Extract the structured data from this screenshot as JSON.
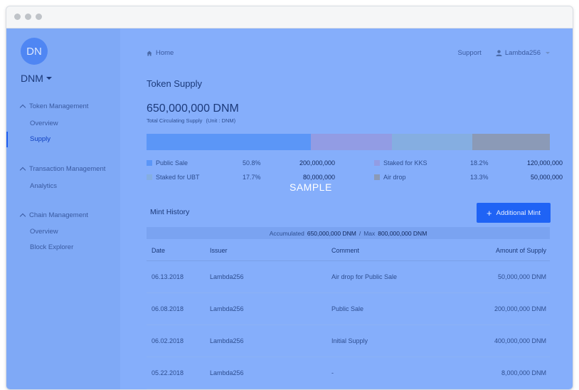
{
  "account": {
    "initials": "DN",
    "name": "DNM"
  },
  "sidebar": {
    "sections": [
      {
        "title": "Token Management",
        "items": [
          "Overview",
          "Supply"
        ]
      },
      {
        "title": "Transaction Management",
        "items": [
          "Analytics"
        ]
      },
      {
        "title": "Chain Management",
        "items": [
          "Overview",
          "Block Explorer"
        ]
      }
    ],
    "active_item": "Supply"
  },
  "header": {
    "breadcrumb": "Home",
    "support": "Support",
    "user": "Lambda256"
  },
  "page": {
    "title": "Token Supply",
    "total": "650,000,000 DNM",
    "total_caption": "Total Circulating Supply",
    "unit_caption": "(Unit : DNM)"
  },
  "distribution": [
    {
      "label": "Public Sale",
      "pct": "50.8%",
      "amount": "200,000,000",
      "share": 0.408,
      "color": "#5b96f7"
    },
    {
      "label": "Staked for KKS",
      "pct": "18.2%",
      "amount": "120,000,000",
      "share": 0.2,
      "color": "#929ce4"
    },
    {
      "label": "Staked for UBT",
      "pct": "17.7%",
      "amount": "80,000,000",
      "share": 0.2,
      "color": "#85aee1"
    },
    {
      "label": "Air drop",
      "pct": "13.3%",
      "amount": "50,000,000",
      "share": 0.192,
      "color": "#8b9ab7"
    }
  ],
  "watermark": "SAMPLE",
  "mint": {
    "title": "Mint History",
    "button_label": "Additional Mint",
    "accumulated_label": "Accumulated",
    "accumulated_value": "650,000,000 DNM",
    "separator": "/",
    "max_label": "Max",
    "max_value": "800,000,000 DNM",
    "columns": [
      "Date",
      "Issuer",
      "Comment",
      "Amount of Supply"
    ],
    "rows": [
      {
        "date": "06.13.2018",
        "issuer": "Lambda256",
        "comment": "Air drop for Public Sale",
        "amount": "50,000,000 DNM"
      },
      {
        "date": "06.08.2018",
        "issuer": "Lambda256",
        "comment": "Public Sale",
        "amount": "200,000,000 DNM"
      },
      {
        "date": "06.02.2018",
        "issuer": "Lambda256",
        "comment": "Initial Supply",
        "amount": "400,000,000 DNM"
      },
      {
        "date": "05.22.2018",
        "issuer": "Lambda256",
        "comment": "-",
        "amount": "8,000,000 DNM"
      }
    ]
  }
}
